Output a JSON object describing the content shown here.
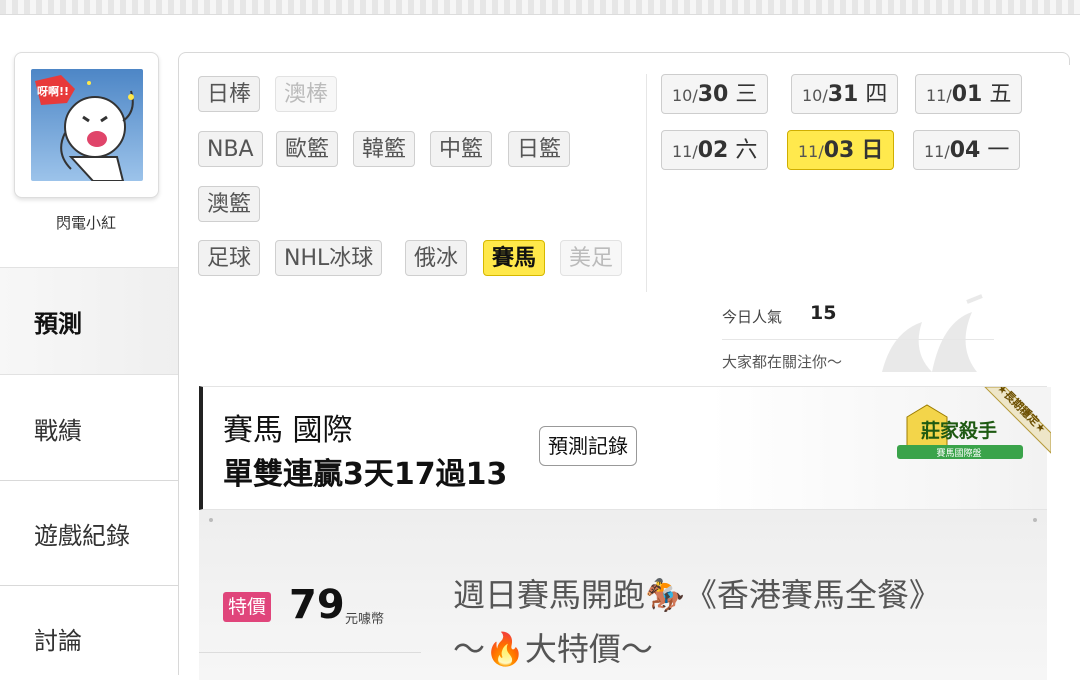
{
  "user": {
    "name": "閃電小紅",
    "avatar_text": "呀啊!!"
  },
  "nav": {
    "items": [
      {
        "label": "預測",
        "active": true
      },
      {
        "label": "戰績",
        "active": false
      },
      {
        "label": "遊戲紀錄",
        "active": false
      },
      {
        "label": "討論",
        "active": false
      }
    ]
  },
  "sports": {
    "rows": [
      [
        {
          "label": "日棒",
          "state": "normal"
        },
        {
          "label": "澳棒",
          "state": "disabled"
        }
      ],
      [
        {
          "label": "NBA",
          "state": "normal"
        },
        {
          "label": "歐籃",
          "state": "normal"
        },
        {
          "label": "韓籃",
          "state": "normal"
        },
        {
          "label": "中籃",
          "state": "normal"
        },
        {
          "label": "日籃",
          "state": "normal"
        }
      ],
      [
        {
          "label": "澳籃",
          "state": "normal"
        }
      ],
      [
        {
          "label": "足球",
          "state": "normal"
        },
        {
          "label": "NHL冰球",
          "state": "normal"
        },
        {
          "label": "俄冰",
          "state": "normal"
        },
        {
          "label": "賽馬",
          "state": "active"
        },
        {
          "label": "美足",
          "state": "disabled"
        }
      ]
    ]
  },
  "dates": [
    {
      "month": "10/",
      "day": "30",
      "weekday": "三",
      "active": false
    },
    {
      "month": "10/",
      "day": "31",
      "weekday": "四",
      "active": false
    },
    {
      "month": "11/",
      "day": "01",
      "weekday": "五",
      "active": false
    },
    {
      "month": "11/",
      "day": "02",
      "weekday": "六",
      "active": false
    },
    {
      "month": "11/",
      "day": "03",
      "weekday": "日",
      "active": true
    },
    {
      "month": "11/",
      "day": "04",
      "weekday": "一",
      "active": false
    }
  ],
  "popularity": {
    "label": "今日人氣",
    "value": "15",
    "note": "大家都在關注你～"
  },
  "game": {
    "title": "賽馬 國際",
    "record": "單雙連贏3天17過13",
    "record_button": "預測記錄",
    "badge_title": "莊家殺手",
    "badge_sub": "賽馬國際盤",
    "ribbon": "★長期穩定★"
  },
  "product": {
    "badge": "特價",
    "price": "79",
    "unit": "元噱幣",
    "title_line1": "週日賽馬開跑🏇《香港賽馬全餐》",
    "title_line2": "～🔥大特價～"
  },
  "colors": {
    "highlight": "#ffe84a",
    "special_badge": "#e0457b"
  }
}
